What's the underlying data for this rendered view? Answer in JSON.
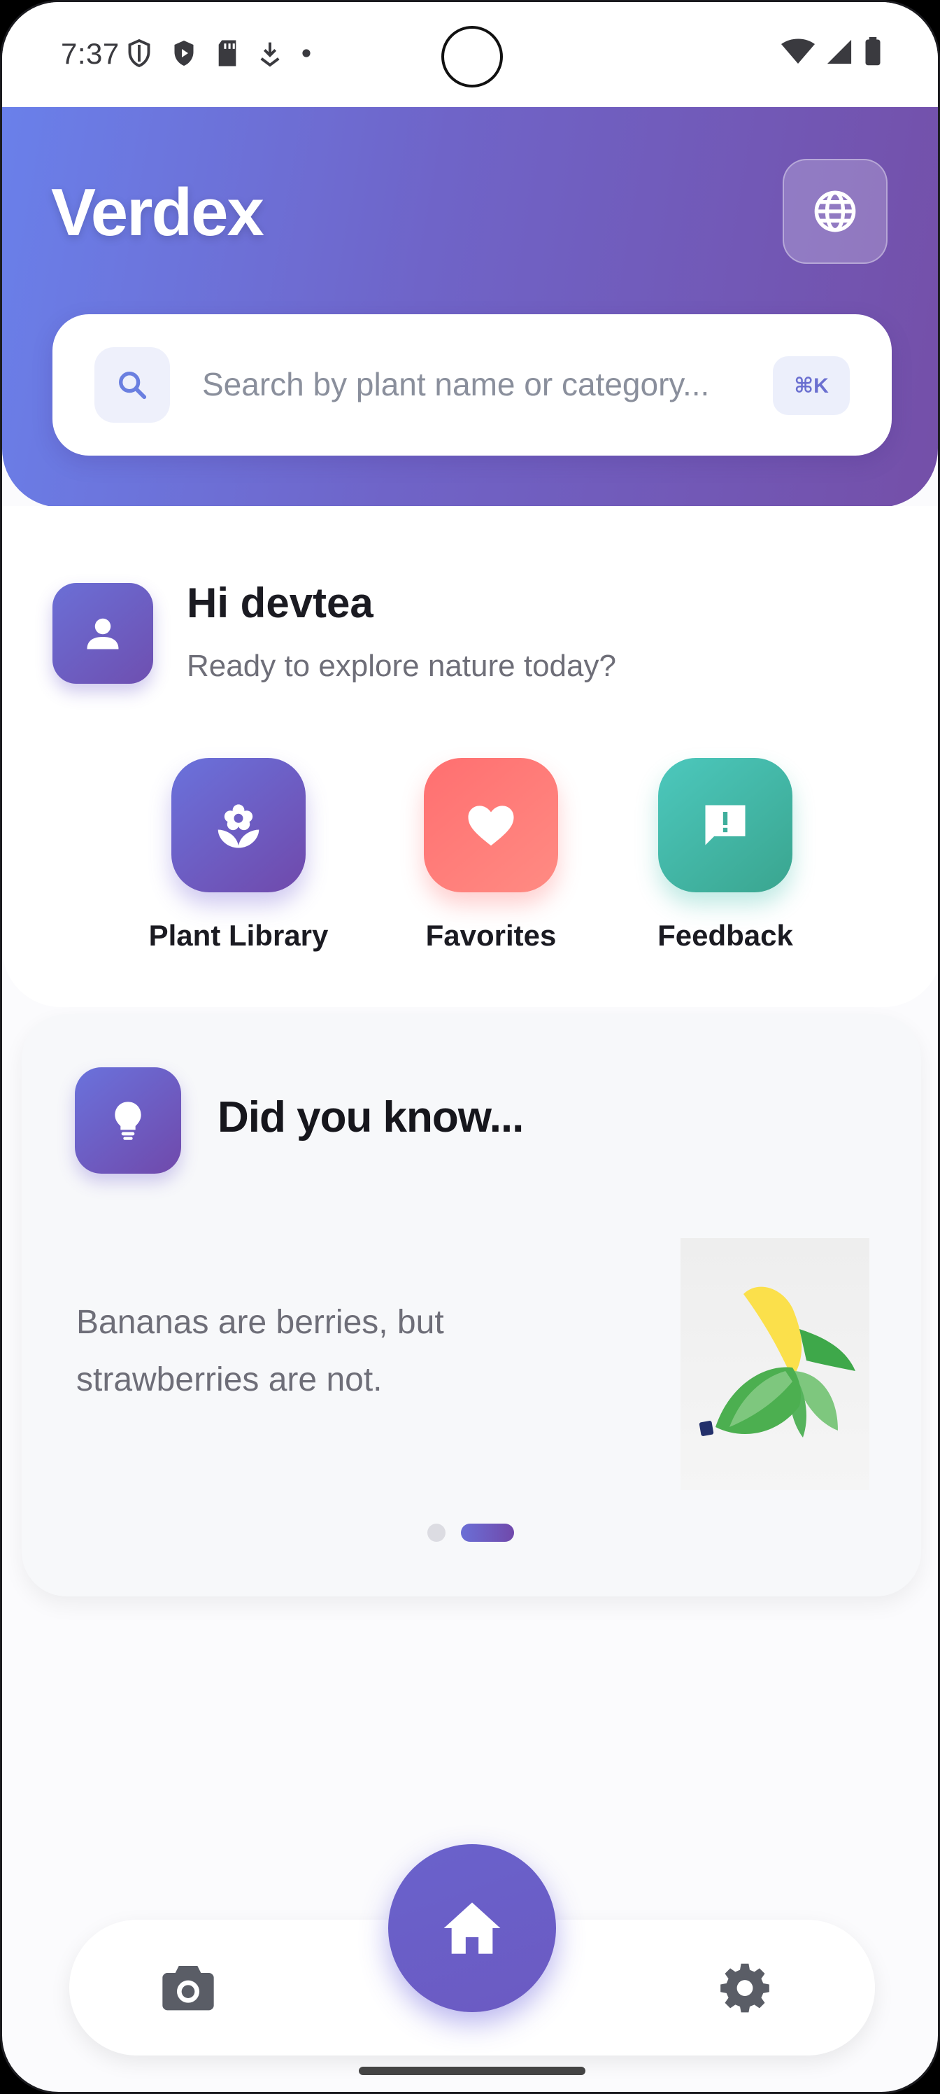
{
  "status_bar": {
    "time": "7:37"
  },
  "header": {
    "brand": "Verdex",
    "language_icon": "globe-icon",
    "search": {
      "placeholder": "Search by plant name or category...",
      "shortcut": "⌘K"
    }
  },
  "greeting": {
    "title": "Hi devtea",
    "subtitle": "Ready to explore nature today?"
  },
  "actions": [
    {
      "label": "Plant Library",
      "icon": "flower-icon",
      "color": "#6a72dc"
    },
    {
      "label": "Favorites",
      "icon": "heart-icon",
      "color": "#ff7576"
    },
    {
      "label": "Feedback",
      "icon": "feedback-icon",
      "color": "#44b8a8"
    }
  ],
  "fact_card": {
    "title": "Did you know...",
    "text": "Bananas are berries, but strawberries are not.",
    "image_icon": "banana-icon",
    "page_count": 2,
    "active_page": 2
  },
  "bottom_nav": {
    "left_icon": "camera-icon",
    "center_icon": "home-icon",
    "right_icon": "gear-icon"
  },
  "colors": {
    "accent": "#6b6fd6",
    "header_gradient_start": "#6a80ea",
    "header_gradient_end": "#744fa8"
  }
}
